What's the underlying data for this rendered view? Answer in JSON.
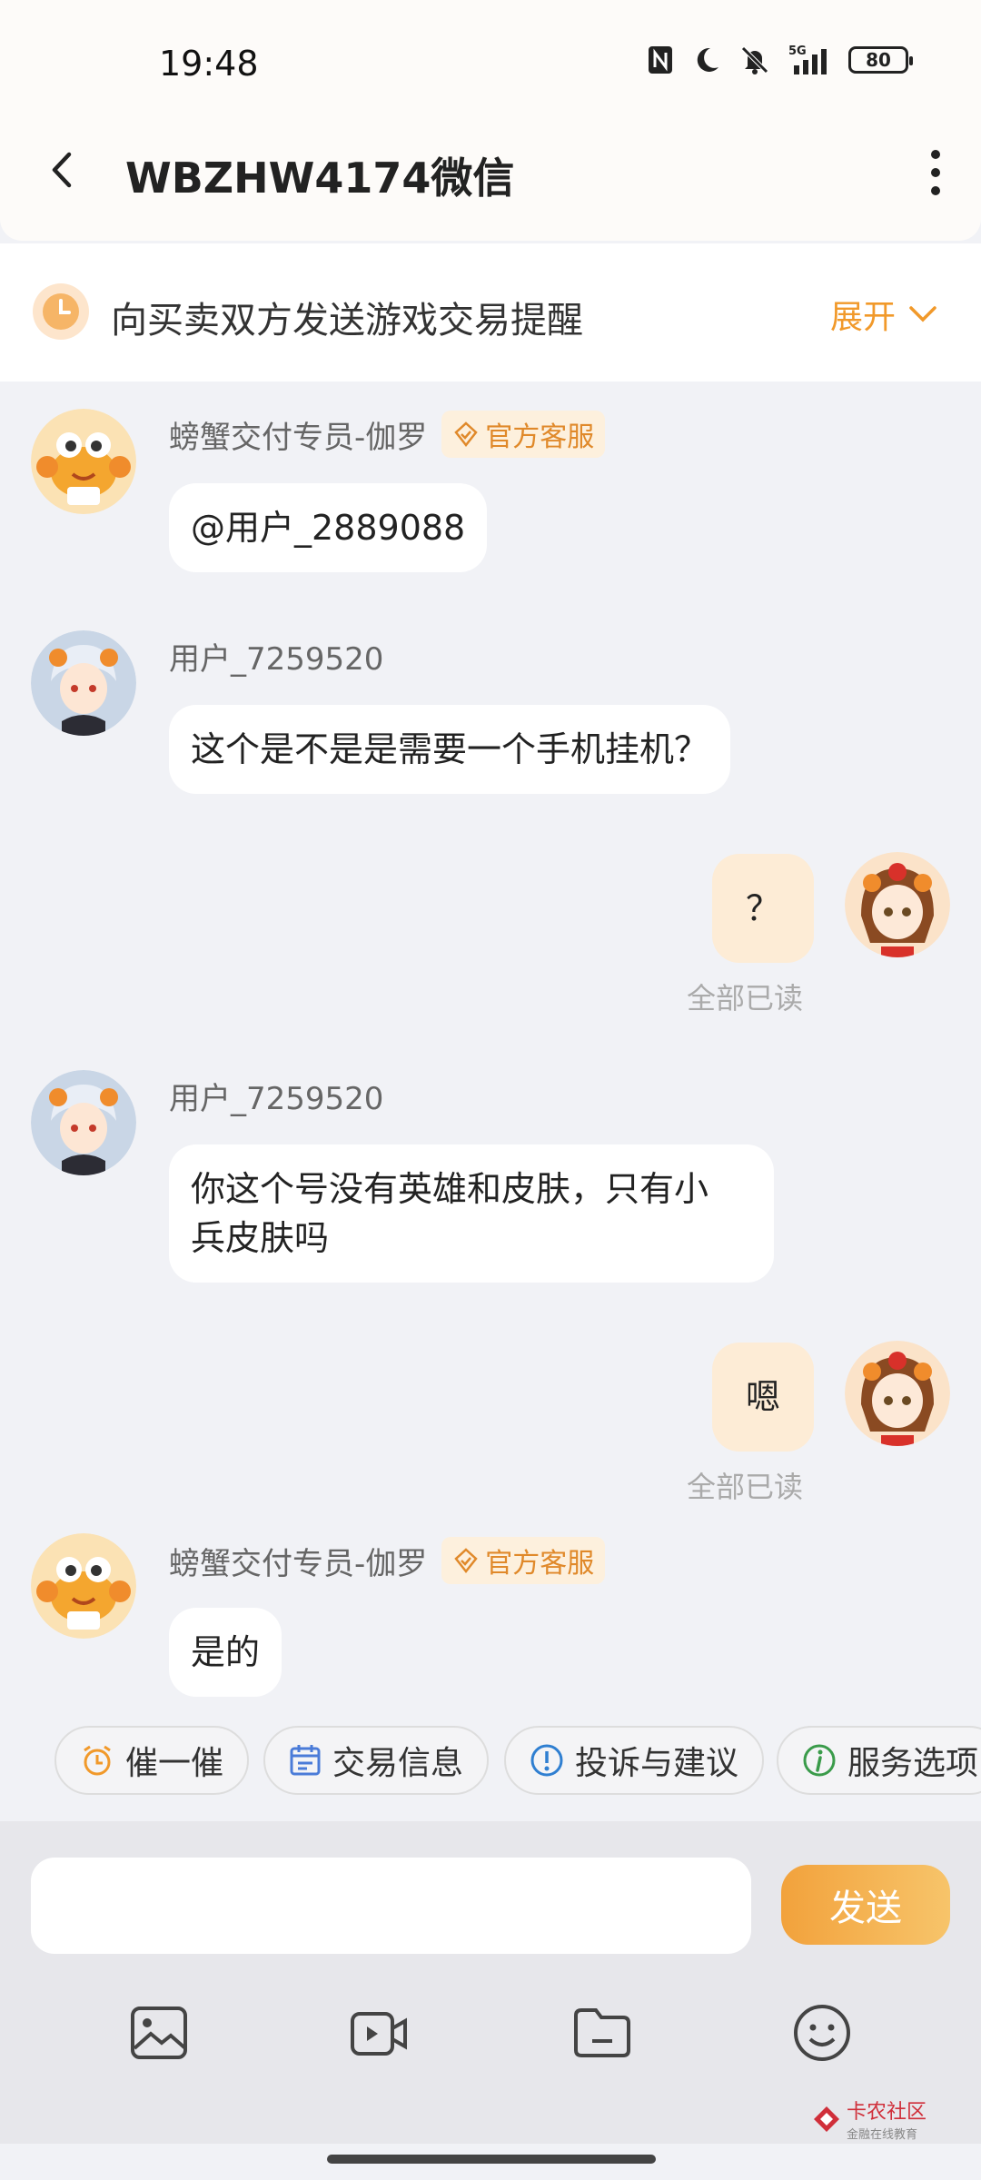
{
  "status": {
    "time": "19:48",
    "battery": "80"
  },
  "header": {
    "title": "WBZHW4174微信"
  },
  "reminder": {
    "text": "向买卖双方发送游戏交易提醒",
    "expand": "展开"
  },
  "messages": [
    {
      "sender": "螃蟹交付专员-伽罗",
      "badge": "官方客服",
      "text": "@用户_2889088"
    },
    {
      "sender": "用户_7259520",
      "text": "这个是不是是需要一个手机挂机？"
    },
    {
      "text": "？",
      "read": "全部已读"
    },
    {
      "sender": "用户_7259520",
      "text": "你这个号没有英雄和皮肤，只有小\n兵皮肤吗"
    },
    {
      "text": "嗯",
      "read": "全部已读"
    },
    {
      "sender": "螃蟹交付专员-伽罗",
      "badge": "官方客服",
      "text": "是的"
    }
  ],
  "quick_actions": [
    "催一催",
    "交易信息",
    "投诉与建议",
    "服务选项"
  ],
  "input": {
    "placeholder": "",
    "send": "发送"
  },
  "watermark": {
    "name": "卡农社区",
    "sub": "金融在线教育"
  },
  "colors": {
    "accent": "#f1992a",
    "my_bubble": "#fdecd6",
    "badge_bg": "#fdf0dd"
  }
}
